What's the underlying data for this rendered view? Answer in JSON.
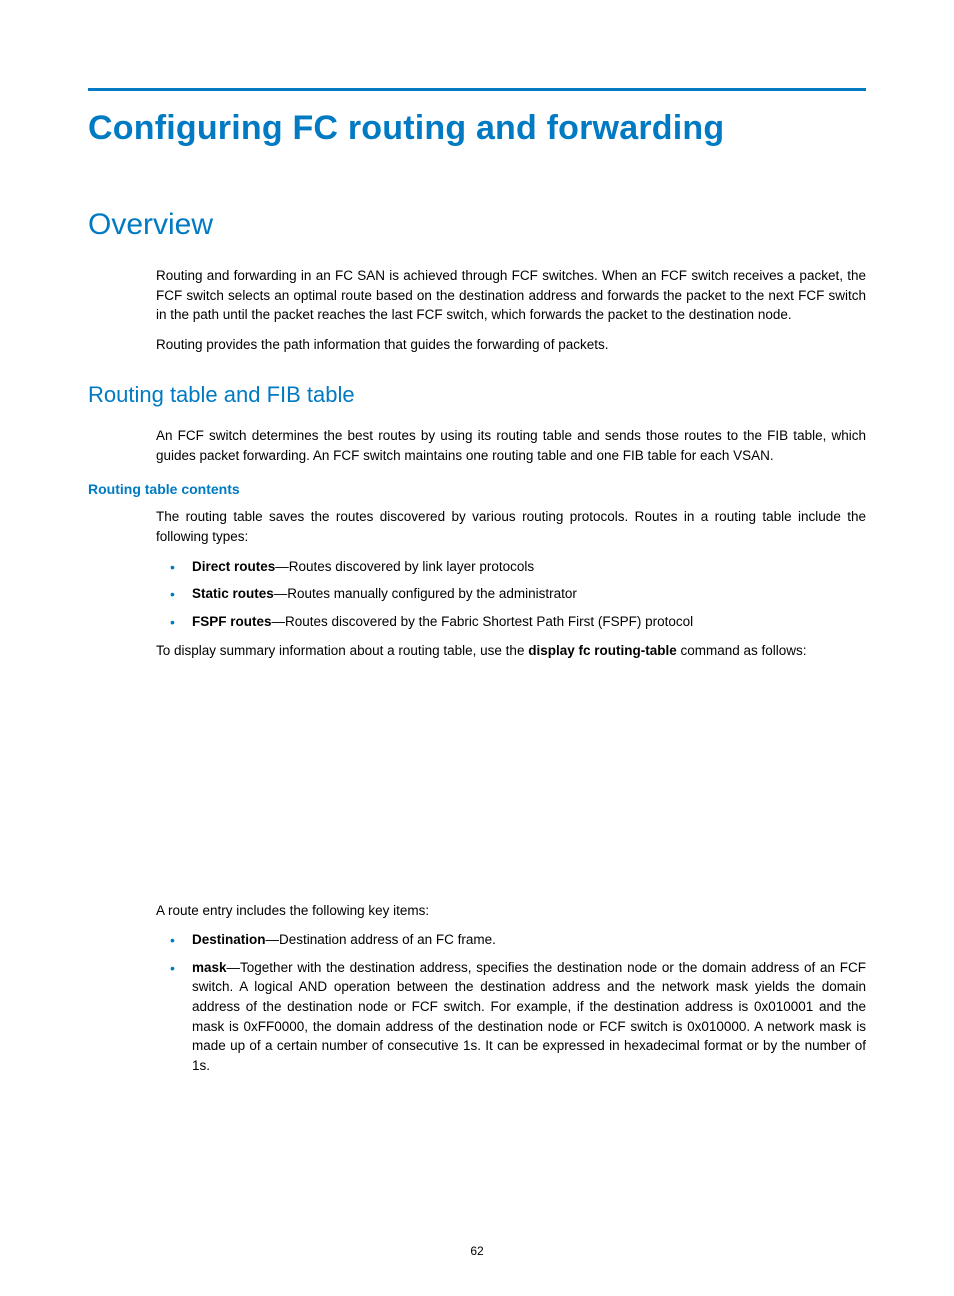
{
  "page_number": "62",
  "h1": "Configuring FC routing and forwarding",
  "overview": {
    "title": "Overview",
    "p1": "Routing and forwarding in an FC SAN is achieved through FCF switches. When an FCF switch receives a packet, the FCF switch selects an optimal route based on the destination address and forwards the packet to the next FCF switch in the path until the packet reaches the last FCF switch, which forwards the packet to the destination node.",
    "p2": "Routing provides the path information that guides the forwarding of packets."
  },
  "routing_fib": {
    "title": "Routing table and FIB table",
    "p1": "An FCF switch determines the best routes by using its routing table and sends those routes to the FIB table, which guides packet forwarding. An FCF switch maintains one routing table and one FIB table for each VSAN."
  },
  "routing_contents": {
    "title": "Routing table contents",
    "p1": "The routing table saves the routes discovered by various routing protocols. Routes in a routing table include the following types:",
    "bullets": [
      {
        "label": "Direct routes",
        "text": "—Routes discovered by link layer protocols"
      },
      {
        "label": "Static routes",
        "text": "—Routes manually configured by the administrator"
      },
      {
        "label": "FSPF routes",
        "text": "—Routes discovered by the Fabric Shortest Path First (FSPF) protocol"
      }
    ],
    "p2a": "To display summary information about a routing table, use the ",
    "p2b": "display fc routing-table",
    "p2c": " command as follows:"
  },
  "route_entry": {
    "p1": "A route entry includes the following key items:",
    "bullets": [
      {
        "label": "Destination",
        "text": "—Destination address of an FC frame."
      },
      {
        "label": "mask",
        "text": "—Together with the destination address, specifies the destination node or the domain address of an FCF switch. A logical AND operation between the destination address and the network mask yields the domain address of the destination node or FCF switch. For example, if the destination address is 0x010001 and the mask is 0xFF0000, the domain address of the destination node or FCF switch is 0x010000. A network mask is made up of a certain number of consecutive 1s. It can be expressed in hexadecimal format or by the number of 1s."
      }
    ]
  }
}
